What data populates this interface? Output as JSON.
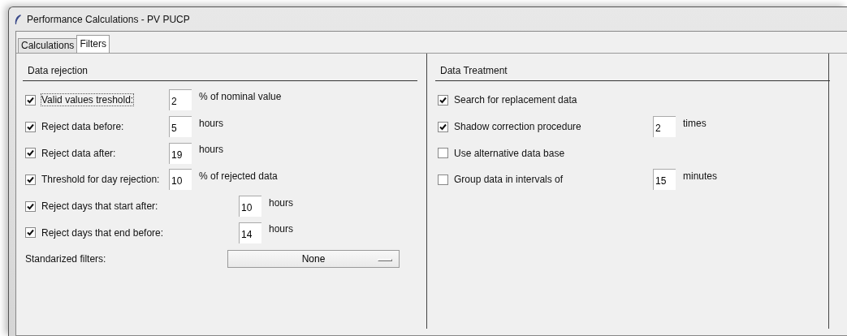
{
  "window": {
    "title": "Performance Calculations - PV PUCP"
  },
  "tabs": [
    {
      "label": "Calculations",
      "selected": false
    },
    {
      "label": "Filters",
      "selected": true
    }
  ],
  "data_rejection": {
    "title": "Data rejection",
    "rows": [
      {
        "kind": "near",
        "label": "Valid values treshold:",
        "checked": true,
        "focused": true,
        "value": "2",
        "unit": "% of nominal value"
      },
      {
        "kind": "near",
        "label": "Reject data before:",
        "checked": true,
        "focused": false,
        "value": "5",
        "unit": "hours"
      },
      {
        "kind": "near",
        "label": "Reject data after:",
        "checked": true,
        "focused": false,
        "value": "19",
        "unit": "hours"
      },
      {
        "kind": "near",
        "label": "Threshold for day rejection:",
        "checked": true,
        "focused": false,
        "value": "10",
        "unit": "% of rejected data"
      },
      {
        "kind": "far",
        "label": "Reject days that start after:",
        "checked": true,
        "focused": false,
        "value": "10",
        "unit": "hours"
      },
      {
        "kind": "far",
        "label": "Reject days that end before:",
        "checked": true,
        "focused": false,
        "value": "14",
        "unit": "hours"
      }
    ],
    "standard_filters": {
      "label": "Standarized filters:",
      "value": "None"
    }
  },
  "data_treatment": {
    "title": "Data Treatment",
    "rows": [
      {
        "kind": "plain",
        "label": "Search for replacement data",
        "checked": true
      },
      {
        "kind": "field",
        "label": "Shadow correction procedure",
        "checked": true,
        "value": "2",
        "unit": "times"
      },
      {
        "kind": "plain",
        "label": "Use alternative data base",
        "checked": false
      },
      {
        "kind": "field",
        "label": "Group data in intervals of",
        "checked": false,
        "value": "15",
        "unit": "minutes"
      }
    ]
  }
}
